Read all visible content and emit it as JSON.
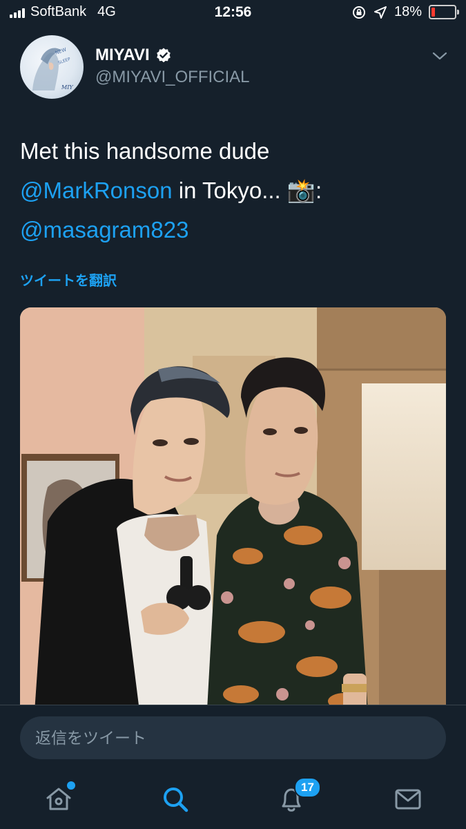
{
  "status_bar": {
    "carrier": "SoftBank",
    "network": "4G",
    "time": "12:56",
    "battery": "18%",
    "battery_level": 0.18,
    "icons": [
      "lock-rotation-icon",
      "location-arrow-icon"
    ]
  },
  "tweet": {
    "author_name": "MIYAVI",
    "verified": true,
    "handle": "@MIYAVI_OFFICIAL",
    "text_line1": "Met this handsome dude",
    "mention1": "@MarkRonson",
    "text_line2_rest": " in Tokyo... 📸:",
    "mention2": "@masagram823",
    "translate_link": "ツイートを翻訳"
  },
  "reply": {
    "placeholder": "返信をツイート"
  },
  "tab_bar": {
    "notification_count": "17",
    "items": [
      "home-icon",
      "search-icon",
      "notifications-icon",
      "messages-icon"
    ]
  },
  "colors": {
    "background": "#15202b",
    "accent": "#1da1f2",
    "secondary_text": "#8899a6",
    "battery_low": "#ff3b30"
  }
}
